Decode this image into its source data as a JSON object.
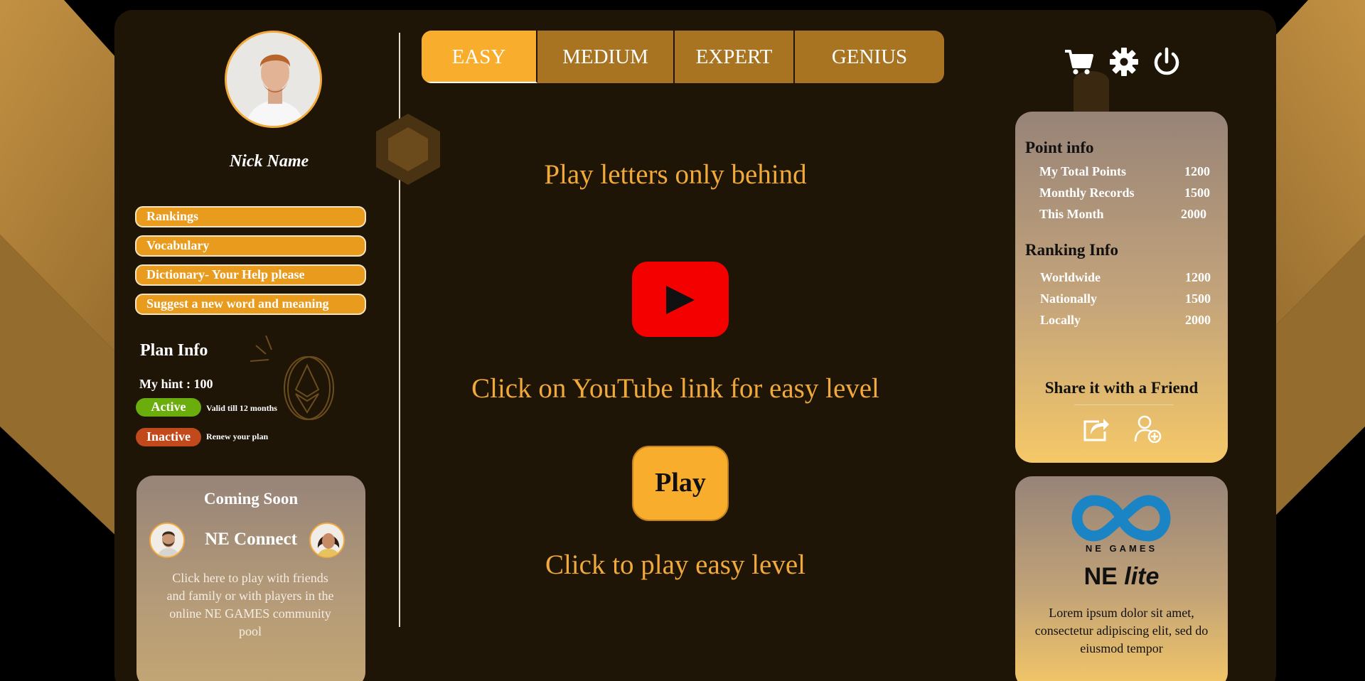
{
  "profile": {
    "nickname": "Nick Name"
  },
  "menu": [
    {
      "label": "Rankings"
    },
    {
      "label": "Vocabulary"
    },
    {
      "label": "Dictionary- Your Help please"
    },
    {
      "label": "Suggest a new word and meaning"
    }
  ],
  "plan": {
    "title": "Plan Info",
    "hint": "My hint : 100",
    "active_label": "Active",
    "active_note": "Valid till 12 months",
    "inactive_label": "Inactive",
    "inactive_note": "Renew your plan"
  },
  "coming_soon": {
    "title": "Coming Soon",
    "name": "NE Connect",
    "description": "Click here to play with friends and family or with players in the online NE GAMES community pool"
  },
  "tabs": [
    {
      "label": "EASY",
      "selected": true
    },
    {
      "label": "MEDIUM",
      "selected": false
    },
    {
      "label": "EXPERT",
      "selected": false
    },
    {
      "label": "GENIUS",
      "selected": false
    }
  ],
  "main": {
    "headline": "Play letters only behind",
    "youtube_caption": "Click on YouTube link for easy level",
    "play_label": "Play",
    "play_caption": "Click to play easy level"
  },
  "toolbar": {
    "icons": [
      "cart-icon",
      "gear-icon",
      "power-icon"
    ]
  },
  "point_info": {
    "title": "Point info",
    "rows": [
      {
        "label": "My Total Points",
        "value": "1200"
      },
      {
        "label": "Monthly Records",
        "value": "1500"
      },
      {
        "label": "This Month",
        "value": "2000"
      }
    ]
  },
  "ranking_info": {
    "title": "Ranking Info",
    "rows": [
      {
        "label": "Worldwide",
        "value": "1200"
      },
      {
        "label": "Nationally",
        "value": "1500"
      },
      {
        "label": "Locally",
        "value": "2000"
      }
    ]
  },
  "share": {
    "title": "Share it with a Friend"
  },
  "brand": {
    "caption": "NE GAMES",
    "name_main": "NE",
    "name_italic": "lite",
    "description": "Lorem ipsum dolor sit amet, consectetur adipiscing elit, sed do eiusmod tempor"
  },
  "colors": {
    "accent": "#f8ad2c",
    "panel": "#1e1507",
    "active": "#6aad0c",
    "inactive": "#c2491c",
    "youtube": "#f50000",
    "brand_blue": "#1a84c4"
  }
}
